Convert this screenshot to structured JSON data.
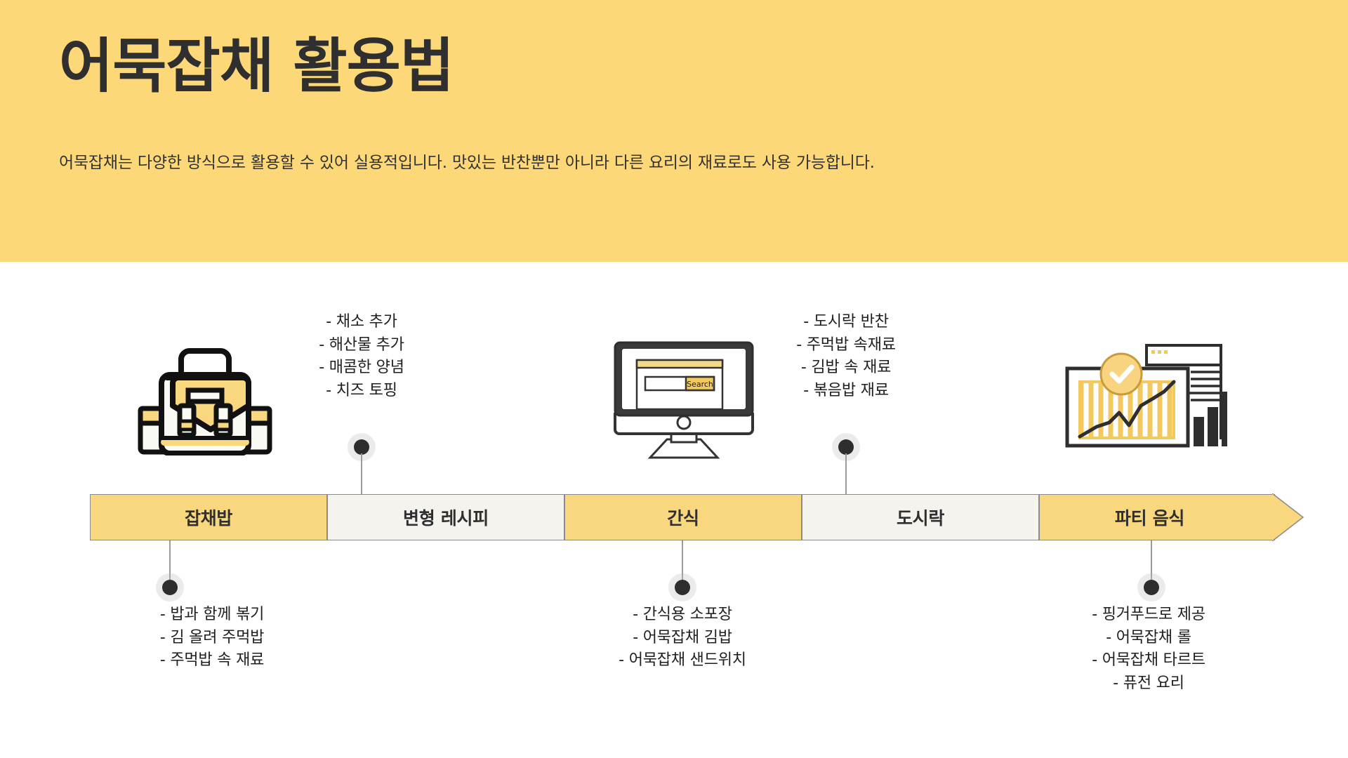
{
  "header": {
    "title": "어묵잡채 활용법",
    "subtitle": "어묵잡채는 다양한 방식으로 활용할 수 있어 실용적입니다. 맛있는 반찬뿐만 아니라 다른 요리의 재료로도 사용 가능합니다.",
    "background_color": "#FDD878"
  },
  "colors": {
    "accent_yellow": "#F9D77E",
    "light_segment": "#F5F3EE",
    "text_dark": "#2F2F2F",
    "connector_dot": "#2E2E2E",
    "connector_line": "#9B9B9B"
  },
  "timeline": {
    "segments": [
      {
        "label": "잡채밥",
        "style": "yellow"
      },
      {
        "label": "변형 레시피",
        "style": "light"
      },
      {
        "label": "간식",
        "style": "yellow"
      },
      {
        "label": "도시락",
        "style": "light"
      },
      {
        "label": "파티 음식",
        "style": "yellow"
      }
    ]
  },
  "notes": {
    "japchae_bap": [
      "- 밥과 함께 볶기",
      "- 김 올려 주먹밥",
      "- 주먹밥 속 재료"
    ],
    "variant_recipe": [
      "- 채소 추가",
      "- 해산물 추가",
      "- 매콤한 양념",
      "- 치즈 토핑"
    ],
    "snack": [
      "- 간식용 소포장",
      "- 어묵잡채 김밥",
      "- 어묵잡채 샌드위치"
    ],
    "lunchbox": [
      "- 도시락 반찬",
      "- 주먹밥 속재료",
      "- 김밥 속 재료",
      "- 볶음밥 재료"
    ],
    "party_food": [
      "- 핑거푸드로 제공",
      "- 어묵잡채 롤",
      "- 어묵잡채 타르트",
      "- 퓨전 요리"
    ]
  },
  "icons": {
    "briefcase": "briefcase-icon",
    "monitor": "monitor-search-icon",
    "dashboard": "analytics-dashboard-icon",
    "monitor_search_label": "Search"
  }
}
